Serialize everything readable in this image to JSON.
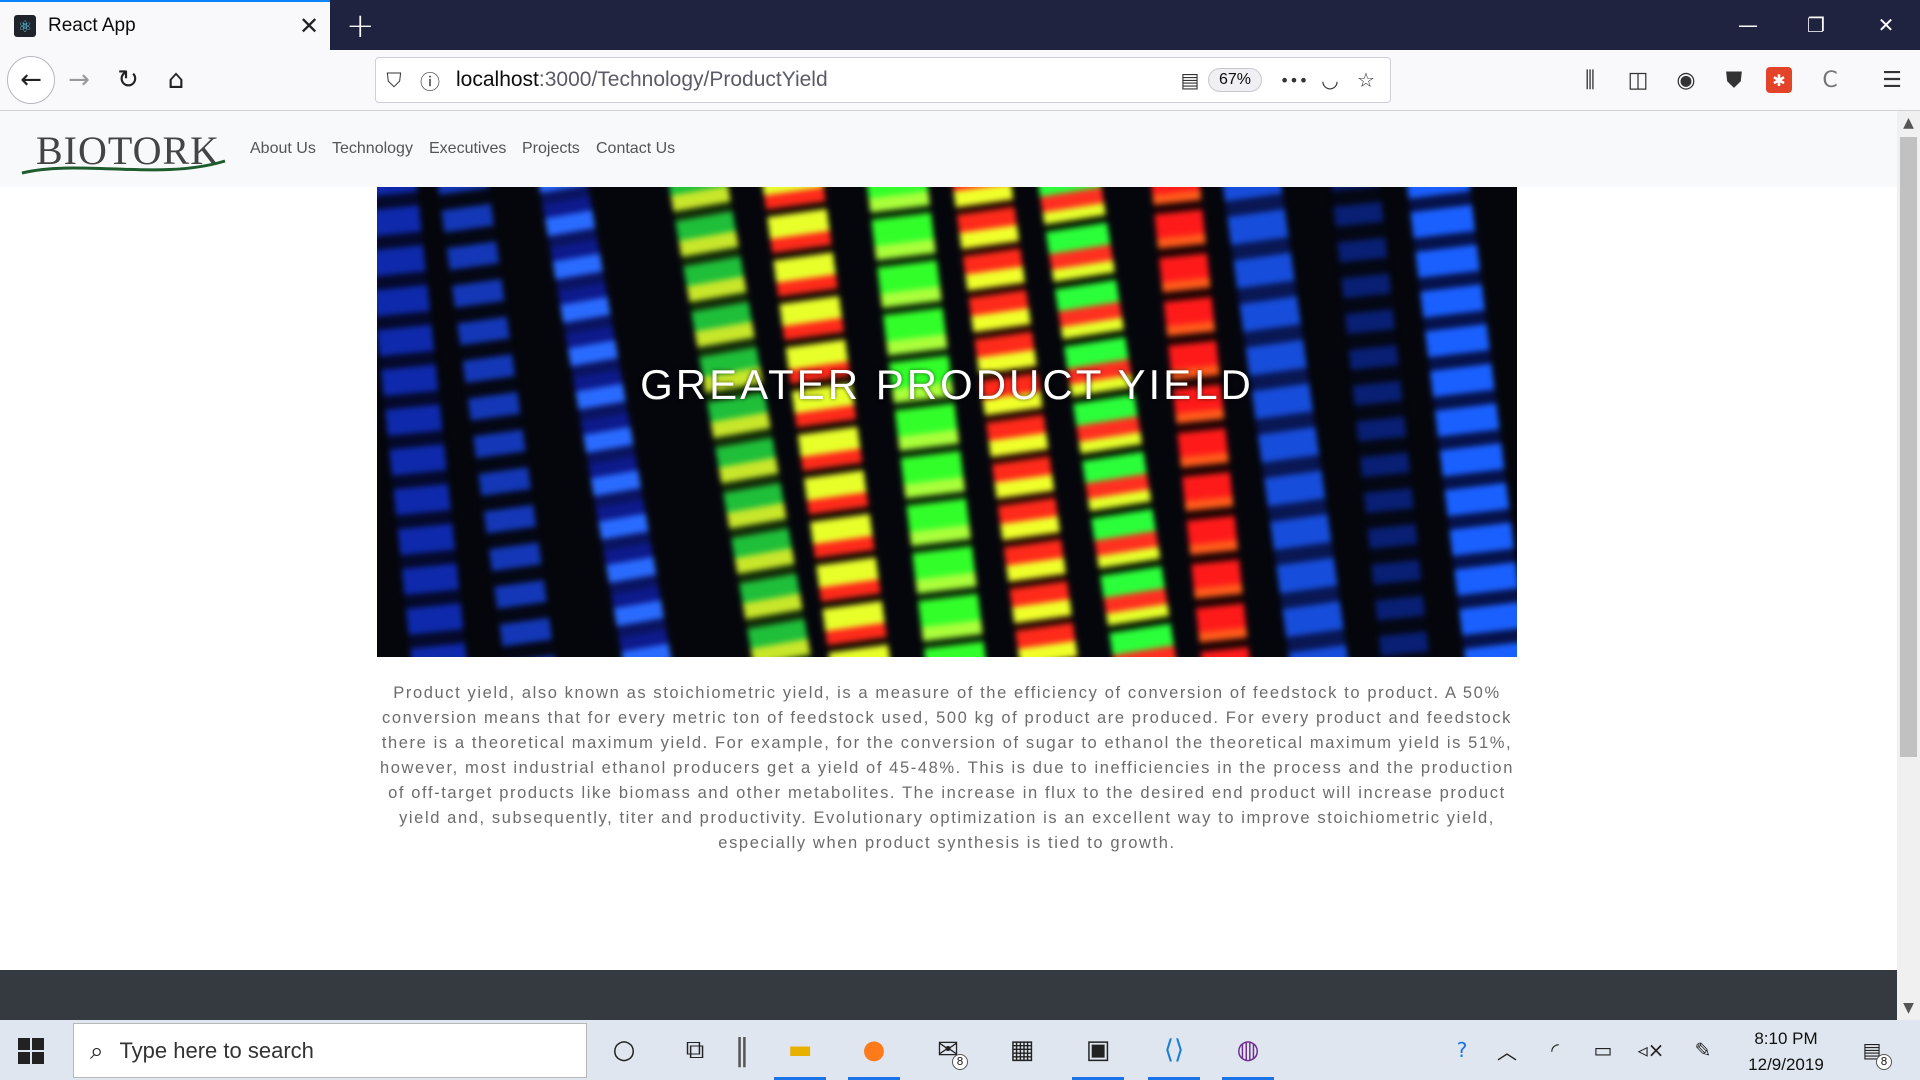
{
  "browser": {
    "tab_title": "React App",
    "tab_close": "✕",
    "new_tab": "+",
    "url_host": "localhost",
    "url_rest": ":3000/Technology/ProductYield",
    "zoom": "67%",
    "more": "•••",
    "window": {
      "minimize": "—",
      "restore": "❐",
      "close": "✕"
    }
  },
  "site": {
    "logo": "BIOTORK",
    "nav": [
      "About Us",
      "Technology",
      "Executives",
      "Projects",
      "Contact Us"
    ],
    "hero_title": "GREATER PRODUCT YIELD",
    "body": "Product yield, also known as stoichiometric yield, is a measure of the efficiency of conversion of feedstock to product. A 50% conversion means that for every metric ton of feedstock used, 500 kg of product are produced. For every product and feedstock there is a theoretical maximum yield. For example, for the conversion of sugar to ethanol the theoretical maximum yield is 51%, however, most industrial ethanol producers get a yield of 45-48%. This is due to inefficiencies in the process and the production of off-target products like biomass and other metabolites. The increase in flux to the desired end product will increase product yield and, subsequently, titer and productivity. Evolutionary optimization is an excellent way to improve stoichiometric yield, especially when product synthesis is tied to growth."
  },
  "taskbar": {
    "search_placeholder": "Type here to search",
    "mail_badge": "8",
    "notif_badge": "8",
    "time": "8:10 PM",
    "date": "12/9/2019"
  }
}
